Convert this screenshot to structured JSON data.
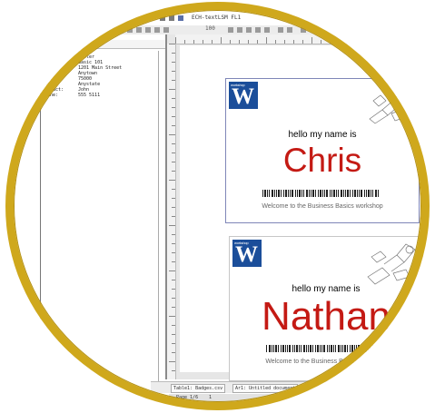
{
  "window": {
    "title": "ECH-textLSM FL1"
  },
  "toolbar": {
    "zoom_label": "100"
  },
  "left_panel": {
    "header_key": "Name",
    "header_value": "Name",
    "fields": [
      {
        "key": "Name:",
        "value": "Chris"
      },
      {
        "key": "Last:",
        "value": "Sloter"
      },
      {
        "key": "Title:",
        "value": "Basic 101"
      },
      {
        "key": "Street:",
        "value": "1201 Main Street"
      },
      {
        "key": "City:",
        "value": "Anytown"
      },
      {
        "key": "ZIP:",
        "value": "75000"
      },
      {
        "key": "State:",
        "value": "Anystate"
      },
      {
        "key": "Contact:",
        "value": "John"
      },
      {
        "key": "Phone:",
        "value": "555 5111"
      }
    ]
  },
  "cards": [
    {
      "logo_text": "workshop",
      "logo_letter": "W",
      "greeting": "hello my name is",
      "name": "Chris",
      "welcome": "Welcome to the Business Basics workshop"
    },
    {
      "logo_text": "workshop",
      "logo_letter": "W",
      "greeting": "hello my name is",
      "name": "Nathan",
      "welcome": "Welcome to the Business Basics workshop"
    }
  ],
  "status": {
    "tab1": "Table1: Badges.csv",
    "tab2": "Ar1: Untitled document",
    "page_label": "Page 1/6",
    "zoom": "1"
  },
  "colors": {
    "ring": "#cfa81c",
    "name_red": "#c41a14",
    "logo_blue": "#1b4e9a"
  }
}
